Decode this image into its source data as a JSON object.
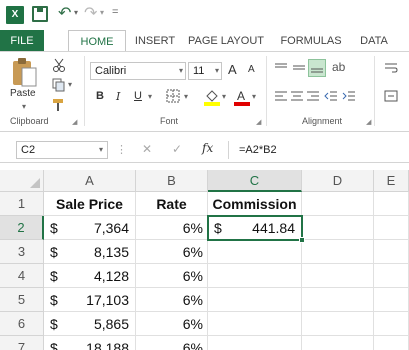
{
  "qat": {
    "app_icon": "X",
    "save_icon": "save-icon",
    "undo_icon": "↶",
    "redo_icon": "↷",
    "dropdown_glyph": "▾",
    "customize_glyph": "="
  },
  "tabs": [
    "FILE",
    "HOME",
    "INSERT",
    "PAGE LAYOUT",
    "FORMULAS",
    "DATA"
  ],
  "ribbon": {
    "clipboard": {
      "paste_label": "Paste",
      "group_label": "Clipboard"
    },
    "font": {
      "font_name": "Calibri",
      "font_size": "11",
      "grow_glyph": "A",
      "shrink_glyph": "A",
      "bold": "B",
      "italic": "I",
      "underline": "U",
      "group_label": "Font"
    },
    "alignment": {
      "group_label": "Alignment"
    },
    "colors": {
      "accent": "#217346",
      "fill": "#ffff00",
      "font_color": "#e00000"
    }
  },
  "formula_bar": {
    "name_box": "C2",
    "cancel_glyph": "✕",
    "enter_glyph": "✓",
    "fx_label": "fx",
    "formula": "=A2*B2"
  },
  "grid": {
    "columns": [
      "A",
      "B",
      "C",
      "D",
      "E"
    ],
    "rows": [
      "1",
      "2",
      "3",
      "4",
      "5",
      "6",
      "7"
    ],
    "headers": {
      "a": "Sale Price",
      "b": "Rate",
      "c": "Commission"
    },
    "currency": "$",
    "data": [
      {
        "price": "7,364",
        "rate": "6%",
        "commission": "441.84"
      },
      {
        "price": "8,135",
        "rate": "6%",
        "commission": ""
      },
      {
        "price": "4,128",
        "rate": "6%",
        "commission": ""
      },
      {
        "price": "17,103",
        "rate": "6%",
        "commission": ""
      },
      {
        "price": "5,865",
        "rate": "6%",
        "commission": ""
      },
      {
        "price": "18,188",
        "rate": "6%",
        "commission": ""
      }
    ],
    "active_cell": "C2"
  }
}
